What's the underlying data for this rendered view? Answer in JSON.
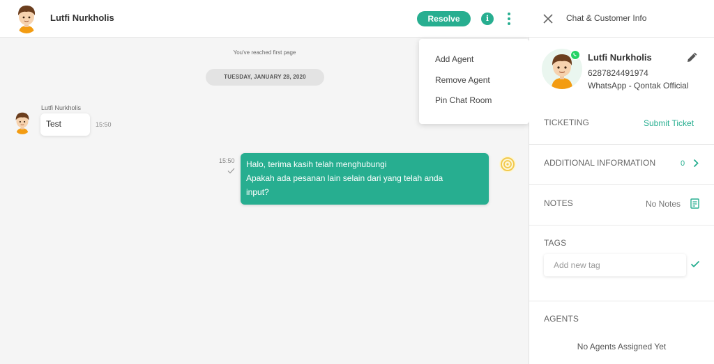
{
  "chat_header": {
    "contact_name": "Lutfi Nurkholis",
    "resolve_label": "Resolve",
    "info_glyph": "i"
  },
  "chat": {
    "first_page_notice": "You've reached first page",
    "date_divider": "TUESDAY, JANUARY 28, 2020",
    "messages": [
      {
        "direction": "incoming",
        "sender": "Lutfi Nurkholis",
        "text": "Test",
        "time": "15:50"
      },
      {
        "direction": "outgoing",
        "line1": "Halo, terima kasih telah menghubungi",
        "line2": "Apakah ada pesanan lain selain dari yang telah anda",
        "line3": "input?",
        "time": "15:50",
        "status": "sent"
      }
    ]
  },
  "menu": {
    "items": [
      "Add Agent",
      "Remove Agent",
      "Pin Chat Room"
    ]
  },
  "panel": {
    "title": "Chat & Customer Info",
    "customer": {
      "name": "Lutfi Nurkholis",
      "phone": "6287824491974",
      "channel": "WhatsApp - Qontak Official"
    },
    "ticketing": {
      "label": "TICKETING",
      "action": "Submit Ticket"
    },
    "additional": {
      "label": "ADDITIONAL INFORMATION",
      "count": "0"
    },
    "notes": {
      "label": "NOTES",
      "value": "No Notes"
    },
    "tags": {
      "label": "TAGS",
      "placeholder": "Add new tag"
    },
    "agents": {
      "label": "AGENTS",
      "empty": "No Agents Assigned Yet"
    }
  },
  "colors": {
    "accent": "#27ae90",
    "whatsapp": "#25d366"
  }
}
